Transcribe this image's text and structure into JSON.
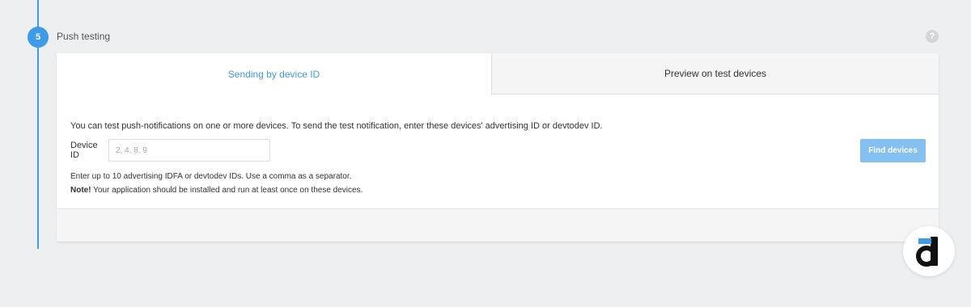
{
  "step": {
    "number": "5",
    "title": "Push testing"
  },
  "help": {
    "icon": "question-icon",
    "glyph": "?"
  },
  "tabs": [
    {
      "label": "Sending by device ID",
      "active": true
    },
    {
      "label": "Preview on test devices",
      "active": false
    }
  ],
  "content": {
    "intro": "You can test push-notifications on one or more devices. To send the test notification, enter these devices' advertising ID or devtodev ID.",
    "device_label": "Device ID",
    "device_value": "",
    "device_placeholder": "2, 4, 8, 9",
    "find_button": "Find devices",
    "hint": "Enter up to 10 advertising IDFA or devtodev IDs. Use a comma as a separator.",
    "note_label": "Note!",
    "note_text": " Your application should be installed and run at least once on these devices."
  },
  "colors": {
    "accent": "#3f9ae8",
    "button_disabled": "#84c0f0",
    "background": "#eeeff1"
  },
  "logo": {
    "icon": "devtodev-logo-icon"
  }
}
